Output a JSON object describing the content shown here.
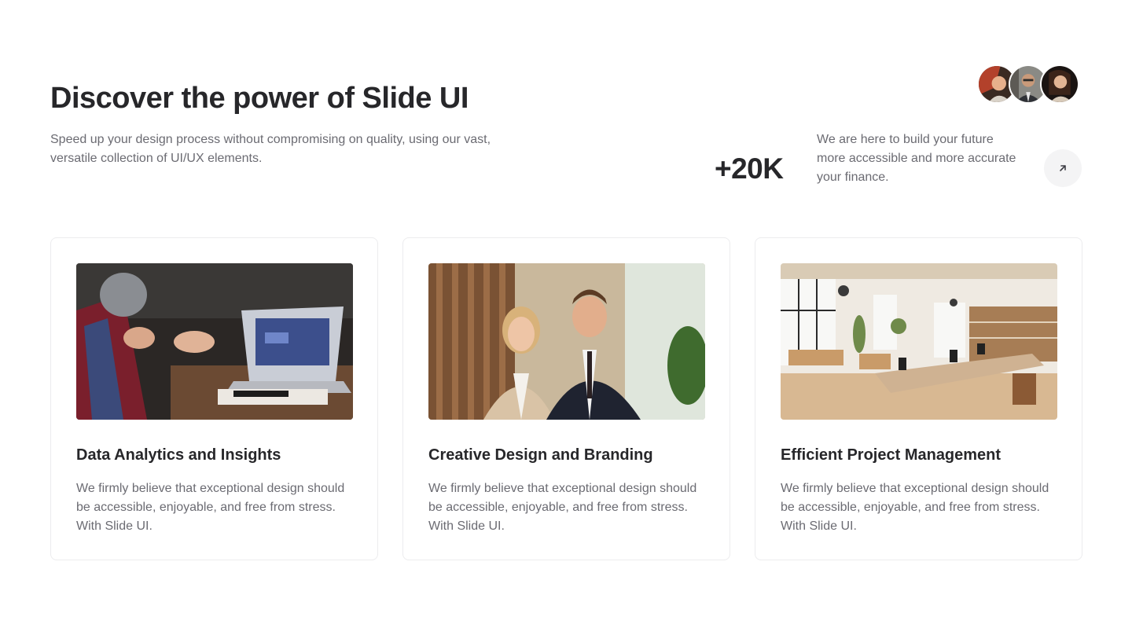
{
  "hero": {
    "title": "Discover the power of Slide UI",
    "subtitle": "Speed up your design process without compromising on quality, using our vast, versatile collection of UI/UX elements."
  },
  "stats": {
    "value": "+20K",
    "description": "We are here to build your future more accessible and more accurate your finance.",
    "avatars": [
      "avatar-photo-woman-red-hair",
      "avatar-photo-man-glasses",
      "avatar-photo-woman-dark-hair"
    ],
    "action_icon": "arrow-up-right-icon"
  },
  "cards": [
    {
      "image": "photo-hands-laptop-meeting",
      "title": "Data Analytics and Insights",
      "text": "We firmly believe that exceptional design should be accessible, enjoyable, and free from stress. With Slide UI."
    },
    {
      "image": "photo-business-couple-portrait",
      "title": "Creative Design and Branding",
      "text": "We firmly believe that exceptional design should be accessible, enjoyable, and free from stress. With Slide UI."
    },
    {
      "image": "photo-bright-open-office",
      "title": "Efficient Project Management",
      "text": "We firmly believe that exceptional design should be accessible, enjoyable, and free from stress. With Slide UI."
    }
  ],
  "colors": {
    "heading": "#27272a",
    "body_text": "#6b6b72",
    "card_border": "#ececee",
    "button_bg": "#f4f4f5"
  }
}
